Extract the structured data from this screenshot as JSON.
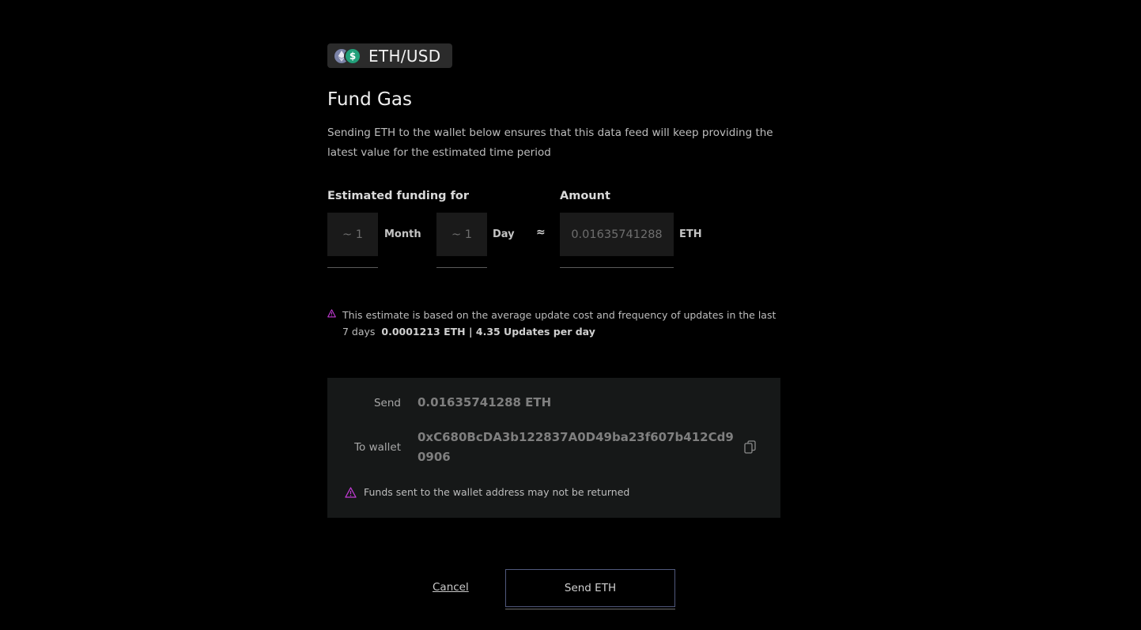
{
  "pair": {
    "name": "ETH/USD",
    "icons": [
      "eth-icon",
      "usd-icon"
    ]
  },
  "title": "Fund Gas",
  "description": "Sending ETH to the wallet below ensures that this data feed will keep providing the latest value for the estimated time period",
  "funding": {
    "label": "Estimated funding for",
    "months_value": "~ 1",
    "months_unit": "Month",
    "days_value": "~ 1",
    "days_unit": "Day",
    "approx_symbol": "≈"
  },
  "amount": {
    "label": "Amount",
    "value": "0.01635741288",
    "unit": "ETH"
  },
  "estimate_note": {
    "text": "This estimate is based on the average update cost and frequency of updates in the last 7 days",
    "stats": "0.0001213 ETH | 4.35 Updates per day"
  },
  "send_panel": {
    "send_label": "Send",
    "send_value": "0.01635741288 ETH",
    "wallet_label": "To wallet",
    "wallet_line1": "0xC680BcDA3b122837A0D49ba23f607b412Cd9",
    "wallet_line2": "0906",
    "warning": "Funds sent to the wallet address may not be returned"
  },
  "actions": {
    "cancel_label": "Cancel",
    "send_label": "Send ETH"
  },
  "colors": {
    "background": "#000000",
    "panel": "#161818",
    "warning_accent": "#c23bd4",
    "usd_coin": "#22a07a",
    "eth_coin": "#7b83a8"
  }
}
